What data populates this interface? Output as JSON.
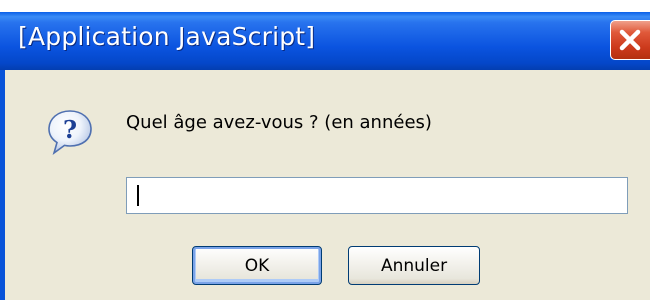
{
  "dialog": {
    "title": "[Application JavaScript]",
    "prompt": "Quel âge avez-vous ? (en années)",
    "input": {
      "value": "",
      "placeholder": ""
    },
    "ok_label": "OK",
    "cancel_label": "Annuler",
    "icon": "question-icon",
    "close_icon": "close-icon"
  },
  "theme": {
    "titlebar_color": "#0b54e0",
    "window_bg": "#ece9d8",
    "close_button_color": "#cc3a1c"
  }
}
